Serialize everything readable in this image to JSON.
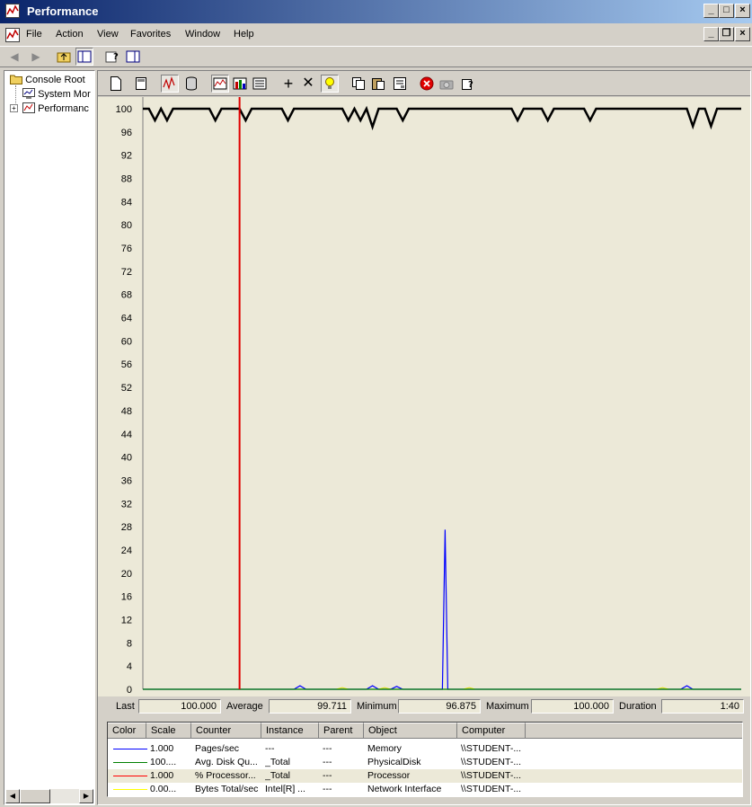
{
  "window": {
    "title": "Performance",
    "buttons": {
      "minimize": "_",
      "maximize": "□",
      "close": "×"
    },
    "mdi_buttons": {
      "minimize": "_",
      "restore": "❐",
      "close": "×"
    }
  },
  "menu": [
    "File",
    "Action",
    "View",
    "Favorites",
    "Window",
    "Help"
  ],
  "tree": {
    "root": "Console Root",
    "items": [
      {
        "label": "System Monitor",
        "display": "System Mor"
      },
      {
        "label": "Performance Logs and Alerts",
        "display": "Performanc"
      }
    ]
  },
  "stats": {
    "last_label": "Last",
    "last": "100.000",
    "average_label": "Average",
    "average": "99.711",
    "minimum_label": "Minimum",
    "minimum": "96.875",
    "maximum_label": "Maximum",
    "maximum": "100.000",
    "duration_label": "Duration",
    "duration": "1:40"
  },
  "legend": {
    "headers": [
      "Color",
      "Scale",
      "Counter",
      "Instance",
      "Parent",
      "Object",
      "Computer"
    ],
    "rows": [
      {
        "color": "#0000ff",
        "scale": "1.000",
        "counter": "Pages/sec",
        "instance": "---",
        "parent": "---",
        "object": "Memory",
        "computer": "\\\\STUDENT-..."
      },
      {
        "color": "#008000",
        "scale": "100....",
        "counter": "Avg. Disk Qu...",
        "instance": "_Total",
        "parent": "---",
        "object": "PhysicalDisk",
        "computer": "\\\\STUDENT-..."
      },
      {
        "color": "#ff0000",
        "scale": "1.000",
        "counter": "% Processor...",
        "instance": "_Total",
        "parent": "---",
        "object": "Processor",
        "computer": "\\\\STUDENT-..."
      },
      {
        "color": "#ffff00",
        "scale": "0.00...",
        "counter": "Bytes Total/sec",
        "instance": "Intel[R] ...",
        "parent": "---",
        "object": "Network Interface",
        "computer": "\\\\STUDENT-..."
      }
    ],
    "selected_row": 2
  },
  "chart_data": {
    "type": "line",
    "ylim": [
      0,
      100
    ],
    "yticks": [
      0,
      4,
      8,
      12,
      16,
      20,
      24,
      28,
      32,
      36,
      40,
      44,
      48,
      52,
      56,
      60,
      64,
      68,
      72,
      76,
      80,
      84,
      88,
      92,
      96,
      100
    ],
    "samples": 100,
    "time_bar_sample": 16,
    "series": [
      {
        "name": "% Processor Time",
        "color": "#000000",
        "width": 2.5,
        "values": [
          100,
          100,
          98,
          100,
          98,
          100,
          100,
          100,
          100,
          100,
          100,
          100,
          98,
          100,
          100,
          100,
          100,
          98,
          100,
          100,
          100,
          100,
          100,
          100,
          98,
          100,
          100,
          100,
          100,
          100,
          100,
          100,
          100,
          100,
          98,
          100,
          98,
          100,
          96.875,
          100,
          100,
          100,
          100,
          98,
          100,
          100,
          100,
          100,
          100,
          100,
          100,
          100,
          100,
          100,
          100,
          100,
          100,
          100,
          100,
          100,
          100,
          100,
          98,
          100,
          100,
          100,
          100,
          98,
          100,
          100,
          100,
          100,
          100,
          100,
          98,
          100,
          100,
          100,
          100,
          100,
          100,
          100,
          100,
          100,
          100,
          100,
          100,
          100,
          100,
          100,
          100,
          97,
          100,
          100,
          97,
          100,
          100,
          100,
          100,
          100
        ]
      },
      {
        "name": "Pages/sec",
        "color": "#0000ff",
        "width": 1.2,
        "values": [
          0,
          0,
          0,
          0,
          0,
          0,
          0,
          0,
          0,
          0,
          0,
          0,
          0,
          0,
          0,
          0,
          0,
          0,
          0,
          0,
          0,
          0,
          0,
          0,
          0,
          0,
          0.6,
          0,
          0,
          0,
          0,
          0,
          0,
          0,
          0,
          0,
          0,
          0,
          0.6,
          0,
          0,
          0,
          0.5,
          0,
          0,
          0,
          0,
          0,
          0,
          0,
          0,
          0,
          0,
          0,
          0,
          0,
          0,
          0,
          0,
          0,
          0,
          0,
          0,
          0,
          0,
          0,
          0,
          0,
          0,
          0,
          0,
          0,
          0,
          0,
          0,
          0,
          0,
          0,
          0,
          0,
          0,
          0,
          0,
          0,
          0,
          0,
          0,
          0,
          0,
          0,
          0.6,
          0,
          0,
          0,
          0,
          0,
          0,
          0,
          0,
          0
        ]
      },
      {
        "name": "Bytes Total/sec",
        "color": "#e0e000",
        "width": 1,
        "values": [
          0,
          0,
          0,
          0,
          0,
          0,
          0,
          0,
          0,
          0,
          0,
          0,
          0,
          0,
          0,
          0,
          0,
          0,
          0,
          0,
          0,
          0,
          0,
          0,
          0,
          0,
          0,
          0,
          0,
          0,
          0,
          0,
          0,
          0.3,
          0,
          0,
          0,
          0,
          0,
          0,
          0.3,
          0,
          0,
          0,
          0,
          0,
          0,
          0,
          0,
          0,
          0,
          0,
          0,
          0,
          0.3,
          0,
          0,
          0,
          0,
          0,
          0,
          0,
          0,
          0,
          0,
          0,
          0,
          0,
          0,
          0,
          0,
          0,
          0,
          0,
          0,
          0,
          0,
          0,
          0,
          0,
          0,
          0,
          0,
          0,
          0,
          0,
          0.3,
          0,
          0,
          0,
          0,
          0,
          0,
          0,
          0,
          0,
          0,
          0,
          0,
          0
        ]
      },
      {
        "name": "Avg. Disk Queue Length",
        "color": "#008000",
        "width": 1.2,
        "values": [
          0,
          0,
          0,
          0,
          0,
          0,
          0,
          0,
          0,
          0,
          0,
          0,
          0,
          0,
          0,
          0,
          0,
          0,
          0,
          0,
          0,
          0,
          0,
          0,
          0,
          0,
          0,
          0,
          0,
          0,
          0,
          0,
          0,
          0,
          0,
          0,
          0,
          0,
          0,
          0,
          0,
          0,
          0,
          0,
          0,
          0,
          0,
          0,
          0,
          0,
          0,
          0,
          0,
          0,
          0,
          0,
          0,
          0,
          0,
          0,
          0,
          0,
          0,
          0,
          0,
          0,
          0,
          0,
          0,
          0,
          0,
          0,
          0,
          0,
          0,
          0,
          0,
          0,
          0,
          0,
          0,
          0,
          0,
          0,
          0,
          0,
          0,
          0,
          0,
          0,
          0,
          0,
          0,
          0,
          0,
          0,
          0,
          0,
          0,
          0
        ]
      }
    ],
    "spike": {
      "series": "Pages/sec",
      "at_sample": 50,
      "value": 27.5
    }
  }
}
